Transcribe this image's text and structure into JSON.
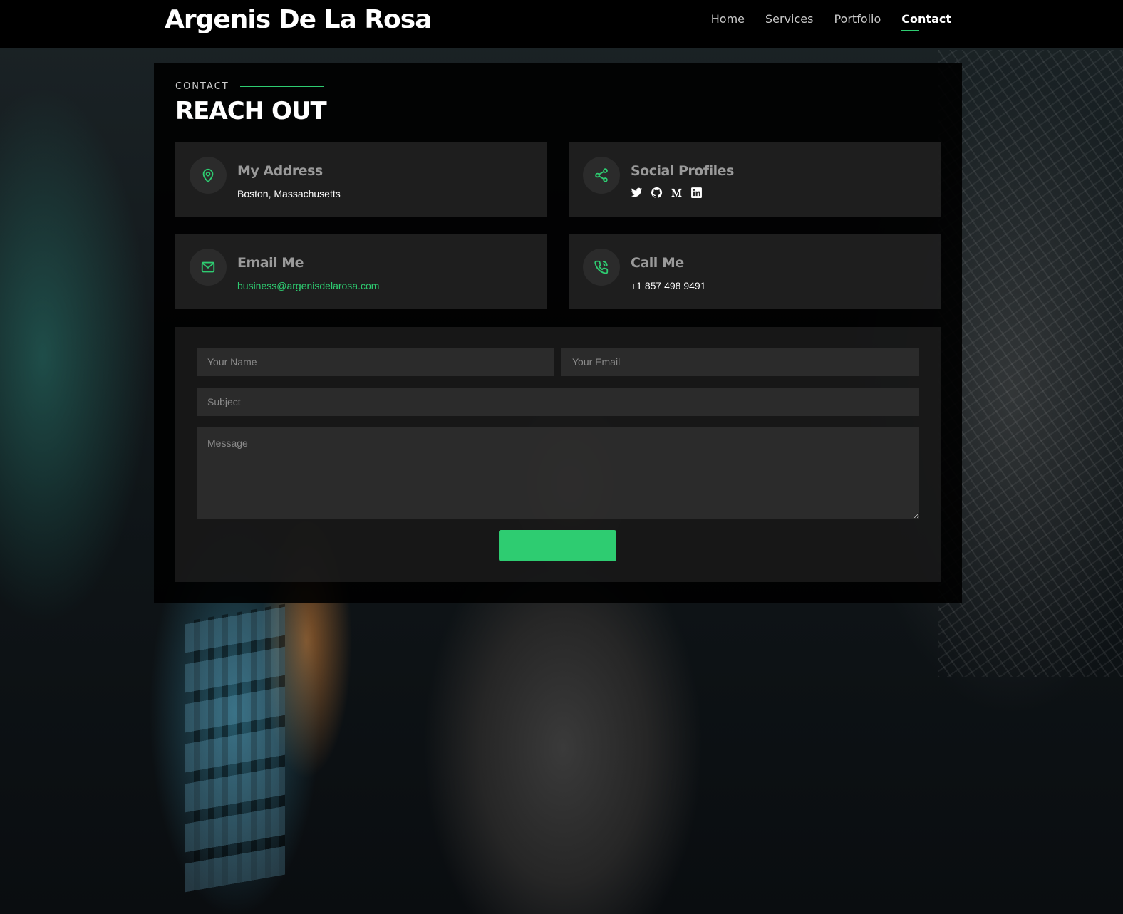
{
  "header": {
    "brand": "Argenis De La Rosa",
    "nav": [
      {
        "label": "Home",
        "active": false
      },
      {
        "label": "Services",
        "active": false
      },
      {
        "label": "Portfolio",
        "active": false
      },
      {
        "label": "Contact",
        "active": true
      }
    ]
  },
  "section": {
    "label": "CONTACT",
    "title": "REACH OUT"
  },
  "cards": {
    "address": {
      "title": "My Address",
      "value": "Boston, Massachusetts",
      "icon": "map-pin-icon"
    },
    "social": {
      "title": "Social Profiles",
      "icons": [
        "twitter-icon",
        "github-icon",
        "medium-icon",
        "linkedin-icon"
      ]
    },
    "email": {
      "title": "Email Me",
      "value": "business@argenisdelarosa.com",
      "icon": "mail-icon"
    },
    "phone": {
      "title": "Call Me",
      "value": "+1 857 498 9491",
      "icon": "phone-icon"
    }
  },
  "form": {
    "name_placeholder": "Your Name",
    "email_placeholder": "Your Email",
    "subject_placeholder": "Subject",
    "message_placeholder": "Message",
    "submit_label": ""
  },
  "colors": {
    "accent": "#2ecc71",
    "header_bg": "#000000",
    "card_bg": "#2a2a2a"
  }
}
